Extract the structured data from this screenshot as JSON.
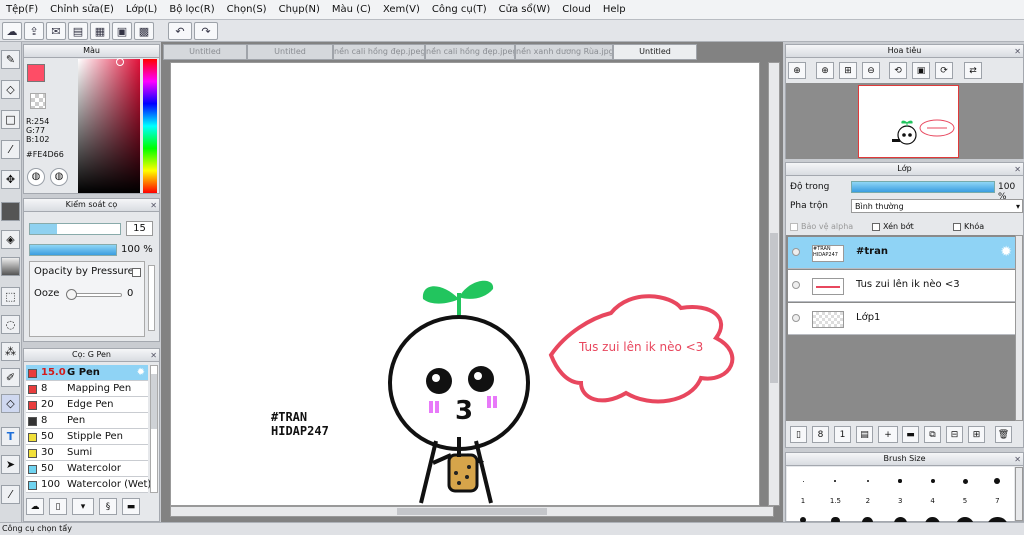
{
  "menu": [
    "Tệp(F)",
    "Chỉnh sửa(E)",
    "Lớp(L)",
    "Bộ lọc(R)",
    "Chọn(S)",
    "Chụp(N)",
    "Màu (C)",
    "Xem(V)",
    "Công cụ(T)",
    "Cửa sổ(W)",
    "Cloud",
    "Help"
  ],
  "color_panel": {
    "title": "Màu",
    "r": "R:254",
    "g": "G:77",
    "b": "B:102",
    "hex": "#FE4D66",
    "main_color": "#fe4d66"
  },
  "brush_control": {
    "title": "Kiểm soát cọ",
    "size": "15",
    "opacity": "100 %",
    "opacity_pressure": "Opacity by Pressure",
    "ooze_label": "Ooze",
    "ooze_value": "0"
  },
  "brush_list": {
    "title": "Cọ: G Pen",
    "items": [
      {
        "size": "15.0",
        "name": "G Pen",
        "color": "#e83d3d"
      },
      {
        "size": "8",
        "name": "Mapping Pen",
        "color": "#e83d3d"
      },
      {
        "size": "20",
        "name": "Edge Pen",
        "color": "#e83d3d"
      },
      {
        "size": "8",
        "name": "Pen",
        "color": "#333333"
      },
      {
        "size": "50",
        "name": "Stipple Pen",
        "color": "#f2e03a"
      },
      {
        "size": "30",
        "name": "Sumi",
        "color": "#f2e03a"
      },
      {
        "size": "50",
        "name": "Watercolor",
        "color": "#6fd3f0"
      },
      {
        "size": "100",
        "name": "Watercolor (Wet)",
        "color": "#6fd3f0"
      }
    ]
  },
  "tabs": [
    "Untitled",
    "Untitled",
    "nền cali hồng đẹp.jpeg",
    "nền cali hồng đẹp.jpeg",
    "nền xanh dương Rùa.jpg",
    "Untitled"
  ],
  "canvas": {
    "tag_text_1": "#TRAN",
    "tag_text_2": "HIDAP247",
    "bubble_text": "Tus zui lên ik nèo <3",
    "bubble_color": "#e8475e",
    "sprout_color": "#22c55e"
  },
  "navigator": {
    "title": "Hoa tiêu"
  },
  "layers": {
    "title": "Lớp",
    "opacity_label": "Độ trong",
    "opacity_value": "100 %",
    "blend_label": "Pha trộn",
    "blend_value": "Bình thường",
    "protect_alpha": "Bảo vệ alpha",
    "clip": "Xén bớt",
    "lock": "Khóa",
    "items": [
      {
        "name": "#tran",
        "thumb": "#TRAN HIDAP247"
      },
      {
        "name": "Tus zui lên ik nèo <3",
        "thumb": ""
      },
      {
        "name": "Lớp1",
        "thumb": ""
      }
    ]
  },
  "brush_size": {
    "title": "Brush Size",
    "sizes": [
      "1",
      "1.5",
      "2",
      "3",
      "4",
      "5",
      "7"
    ]
  },
  "status": "Công cụ chọn tẩy"
}
